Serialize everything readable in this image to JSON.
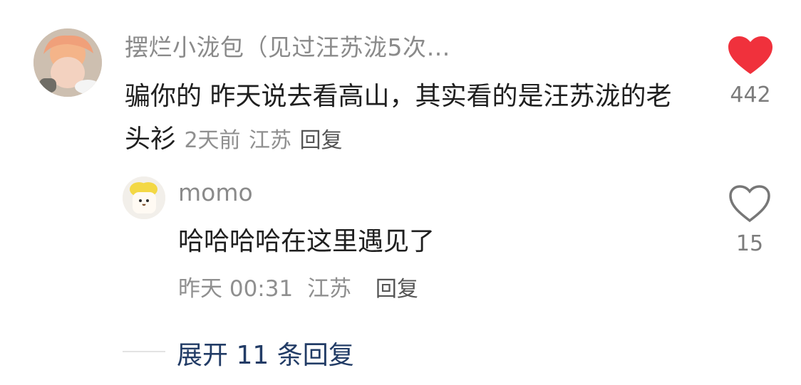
{
  "comment": {
    "username": "摆烂小泷包（见过汪苏泷5次…",
    "text": "骗你的 昨天说去看高山，其实看的是汪苏泷的老头衫",
    "time": "2天前",
    "location": "江苏",
    "reply_label": "回复",
    "likes": "442",
    "liked": true
  },
  "reply": {
    "username": "momo",
    "text": "哈哈哈哈在这里遇见了",
    "time": "昨天 00:31",
    "location": "江苏",
    "reply_label": "回复",
    "likes": "15",
    "liked": false
  },
  "expand": {
    "label": "展开 11 条回复"
  },
  "colors": {
    "like_red": "#f0313c",
    "expand_blue": "#223c66"
  },
  "icons": {
    "main_like": "heart-filled-icon",
    "reply_like": "heart-outline-icon"
  }
}
